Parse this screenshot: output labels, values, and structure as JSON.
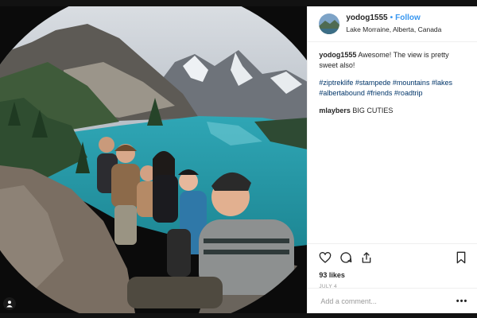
{
  "post": {
    "username": "yodog1555",
    "follow_label": "Follow",
    "location": "Lake Morraine, Alberta, Canada",
    "caption_username": "yodog1555",
    "caption_text": "Awesome! The view is pretty sweet also!",
    "hashtags": "#ziptreklife #stampede #mountains #lakes #albertabound #friends #roadtrip",
    "comment_username": "mlaybers",
    "comment_text": "BIG CUTIES",
    "likes": "93 likes",
    "date": "JULY 4",
    "add_comment_placeholder": "Add a comment...",
    "more_label": "•••"
  },
  "icons": {
    "like": "heart-icon",
    "comment": "speech-bubble-icon",
    "share": "share-icon",
    "save": "bookmark-icon",
    "user_tag": "person-icon"
  },
  "colors": {
    "accent": "#3897f0",
    "hashtag": "#003569",
    "text": "#262626",
    "muted": "#999999",
    "backdrop": "#121212"
  }
}
